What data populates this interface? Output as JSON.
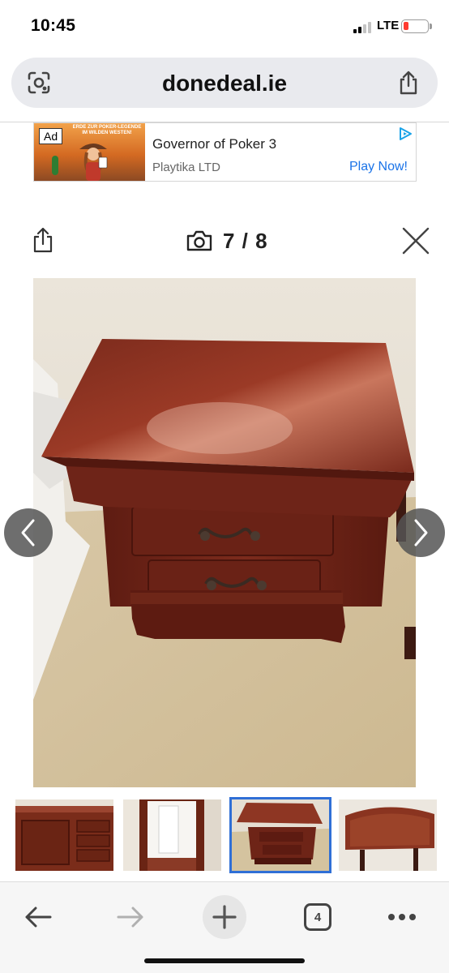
{
  "status_bar": {
    "time": "10:45",
    "network": "LTE",
    "signal_bars": 4,
    "signal_bars_active": 2,
    "battery_level": 0.15,
    "battery_color": "#ff3b30"
  },
  "browser": {
    "url": "donedeal.ie",
    "lens_icon": "camera-search-icon",
    "share_icon": "share-icon"
  },
  "ad": {
    "badge": "Ad",
    "title": "Governor of Poker 3",
    "advertiser": "Playtika LTD",
    "cta": "Play Now!",
    "image_caption": "ERDE ZUR POKER-LEGENDE IM WILDEN WESTEN!",
    "cta_color": "#1a73e8"
  },
  "gallery": {
    "counter": "7 / 8",
    "current": 7,
    "total": 8,
    "share_icon": "share-icon",
    "camera_icon": "camera-icon",
    "close_icon": "close-icon",
    "prev_icon": "chevron-left-icon",
    "next_icon": "chevron-right-icon",
    "photo_subject": "mahogany bedside locker with two drawers",
    "thumbnails": [
      {
        "subject": "sideboard",
        "selected": false
      },
      {
        "subject": "mirror",
        "selected": false
      },
      {
        "subject": "bedside locker",
        "selected": true
      },
      {
        "subject": "headboard",
        "selected": false
      }
    ],
    "selected_border_color": "#2f6fd6"
  },
  "toolbar": {
    "back_icon": "arrow-left-icon",
    "forward_icon": "arrow-right-icon",
    "new_tab_icon": "plus-icon",
    "tab_count": "4",
    "menu_icon": "more-horizontal-icon"
  }
}
